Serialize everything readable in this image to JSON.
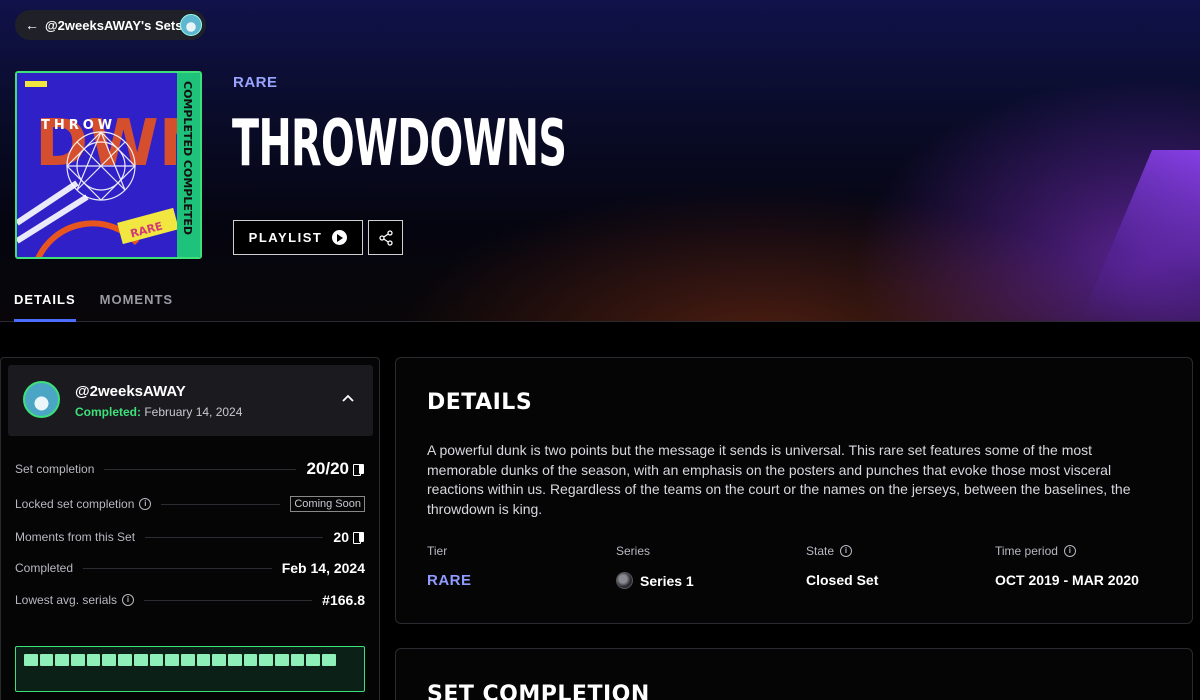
{
  "nav": {
    "back_label": "@2weeksAWAY's Sets"
  },
  "set": {
    "tier": "RARE",
    "title": "THROWDOWNS",
    "art": {
      "word": "THROW",
      "badge": "RARE",
      "side_text": "COMPLETED COMPLETED"
    }
  },
  "actions": {
    "playlist_label": "PLAYLIST"
  },
  "tabs": [
    {
      "label": "DETAILS",
      "active": true
    },
    {
      "label": "MOMENTS",
      "active": false
    }
  ],
  "owner": {
    "name": "@2weeksAWAY",
    "completed_label": "Completed:",
    "completed_date": "February 14, 2024"
  },
  "stats": {
    "set_completion": {
      "label": "Set completion",
      "value": "20/20"
    },
    "locked_completion": {
      "label": "Locked set completion",
      "value": "Coming Soon"
    },
    "moments": {
      "label": "Moments from this Set",
      "value": "20"
    },
    "completed": {
      "label": "Completed",
      "value": "Feb 14, 2024"
    },
    "lowest_serials": {
      "label": "Lowest avg. serials",
      "value": "#166.8"
    }
  },
  "progress": {
    "filled": 20,
    "total": 20
  },
  "details": {
    "title": "DETAILS",
    "description": "A powerful dunk is two points but the message it sends is universal. This rare set features some of the most memorable dunks of the season, with an emphasis on the posters and punches that evoke those most visceral reactions within us. Regardless of the teams on the court or the names on the jerseys, between the baselines, the throwdown is king.",
    "tier": {
      "label": "Tier",
      "value": "RARE"
    },
    "series": {
      "label": "Series",
      "value": "Series 1"
    },
    "state": {
      "label": "State",
      "value": "Closed Set"
    },
    "time_period": {
      "label": "Time period",
      "value": "OCT 2019 - MAR 2020"
    }
  },
  "set_completion_section": {
    "title": "SET COMPLETION"
  },
  "colors": {
    "accent_green": "#3ee07a",
    "rare_blue": "#8f9cff",
    "tab_underline": "#4a6cff"
  }
}
